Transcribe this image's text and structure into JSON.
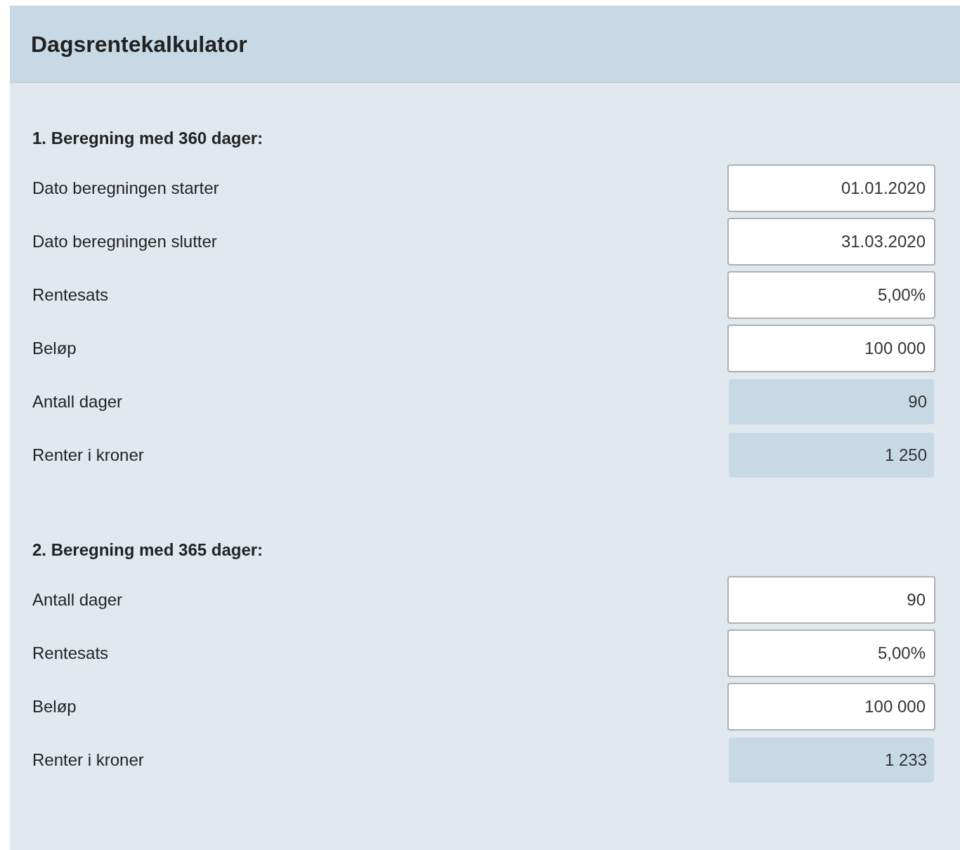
{
  "title": "Dagsrentekalkulator",
  "sections": [
    {
      "heading": "1. Beregning med 360 dager:",
      "rows": [
        {
          "label": "Dato beregningen starter",
          "value": "01.01.2020",
          "kind": "input"
        },
        {
          "label": "Dato beregningen slutter",
          "value": "31.03.2020",
          "kind": "input"
        },
        {
          "label": "Rentesats",
          "value": "5,00%",
          "kind": "input"
        },
        {
          "label": "Beløp",
          "value": "100 000",
          "kind": "input"
        },
        {
          "label": "Antall dager",
          "value": "90",
          "kind": "output"
        },
        {
          "label": "Renter i kroner",
          "value": "1 250",
          "kind": "output"
        }
      ]
    },
    {
      "heading": "2. Beregning med 365 dager:",
      "rows": [
        {
          "label": "Antall dager",
          "value": "90",
          "kind": "input"
        },
        {
          "label": "Rentesats",
          "value": "5,00%",
          "kind": "input"
        },
        {
          "label": "Beløp",
          "value": "100 000",
          "kind": "input"
        },
        {
          "label": "Renter i kroner",
          "value": "1 233",
          "kind": "output"
        }
      ]
    }
  ]
}
